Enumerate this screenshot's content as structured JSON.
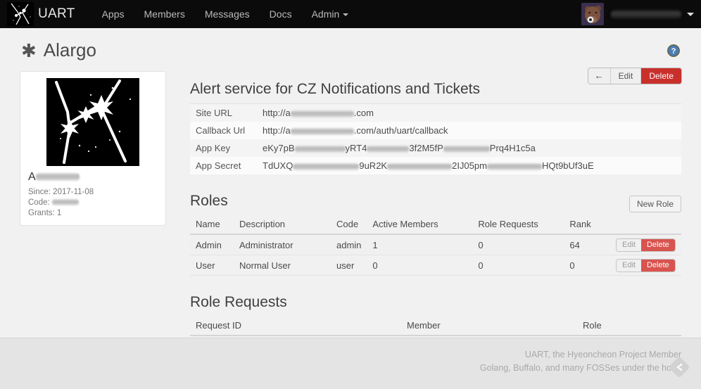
{
  "navbar": {
    "brand": "UART",
    "brand_logo_icon": "constellation-logo-icon",
    "links": [
      {
        "label": "Apps"
      },
      {
        "label": "Members"
      },
      {
        "label": "Messages"
      },
      {
        "label": "Docs"
      },
      {
        "label": "Admin",
        "has_caret": true
      }
    ],
    "user": {
      "avatar_icon": "user-avatar",
      "name": "",
      "caret_icon": "chevron-down-icon"
    },
    "background": "#0b0b0b"
  },
  "page": {
    "icon": "asterisk-icon",
    "icon_glyph": "✱",
    "title": "Alargo",
    "help_icon": "help-circle-icon"
  },
  "toolbar": {
    "back_label": "←",
    "back_icon": "arrow-left-icon",
    "edit_label": "Edit",
    "delete_label": "Delete",
    "delete_color": "#c9302c"
  },
  "app_card": {
    "image_icon": "constellation-image",
    "name": "A",
    "since_label": "Since:",
    "since_value": "2017-11-08",
    "code_label": "Code:",
    "code_value": "",
    "grants_label": "Grants:",
    "grants_value": "1"
  },
  "detail": {
    "heading": "Alert service for CZ Notifications and Tickets",
    "rows": [
      {
        "label": "Site URL",
        "value_prefix": "http://a",
        "value_suffix": ".com"
      },
      {
        "label": "Callback Url",
        "value_prefix": "http://a",
        "value_suffix": ".com/auth/uart/callback"
      },
      {
        "label": "App Key",
        "value_prefix": "eKy7pB",
        "value_mid1": "yRT4",
        "value_mid2": "3f2M5fP",
        "value_suffix": "Prq4H1c5a"
      },
      {
        "label": "App Secret",
        "value_prefix": "TdUXQ",
        "value_mid1": "9uR2K",
        "value_mid2": "2IJ05pm",
        "value_suffix": "HQt9bUf3uE"
      }
    ]
  },
  "roles": {
    "heading": "Roles",
    "new_button": "New Role",
    "columns": [
      "Name",
      "Description",
      "Code",
      "Active Members",
      "Role Requests",
      "Rank"
    ],
    "rows": [
      {
        "name": "Admin",
        "description": "Administrator",
        "code": "admin",
        "active_members": "1",
        "role_requests": "0",
        "rank": "64",
        "edit_label": "Edit",
        "delete_label": "Delete"
      },
      {
        "name": "User",
        "description": "Normal User",
        "code": "user",
        "active_members": "0",
        "role_requests": "0",
        "rank": "0",
        "edit_label": "Edit",
        "delete_label": "Delete"
      }
    ],
    "row_delete_color": "#d9534f"
  },
  "role_requests": {
    "heading": "Role Requests",
    "columns": [
      "Request ID",
      "Member",
      "Role"
    ],
    "rows": []
  },
  "footer": {
    "line1": "UART, the Hyeoncheon Project Member",
    "line2": "Golang, Buffalo, and many FOSSes under the hood",
    "logo_icon": "diamond-logo-icon"
  }
}
